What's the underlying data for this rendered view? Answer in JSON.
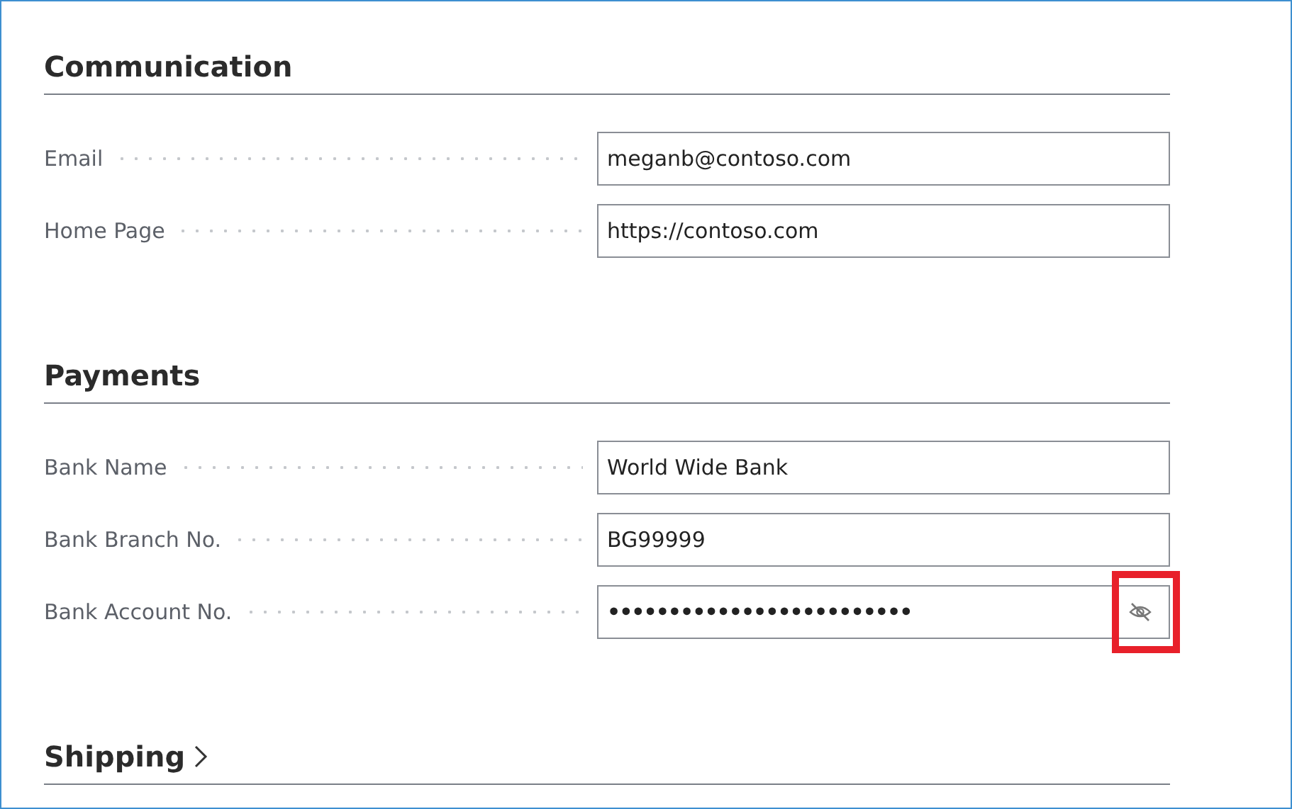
{
  "sections": [
    {
      "title": "Communication",
      "fields": [
        {
          "label": "Email",
          "value": "meganb@contoso.com",
          "kind": "text"
        },
        {
          "label": "Home Page",
          "value": "https://contoso.com",
          "kind": "text"
        }
      ]
    },
    {
      "title": "Payments",
      "fields": [
        {
          "label": "Bank Name",
          "value": "World Wide Bank",
          "kind": "text"
        },
        {
          "label": "Bank Branch No.",
          "value": "BG99999",
          "kind": "text"
        },
        {
          "label": "Bank Account No.",
          "value": "•••••••••••••••••••••••••",
          "kind": "password",
          "highlighted": true
        }
      ]
    },
    {
      "title": "Shipping",
      "expanded": false
    }
  ]
}
